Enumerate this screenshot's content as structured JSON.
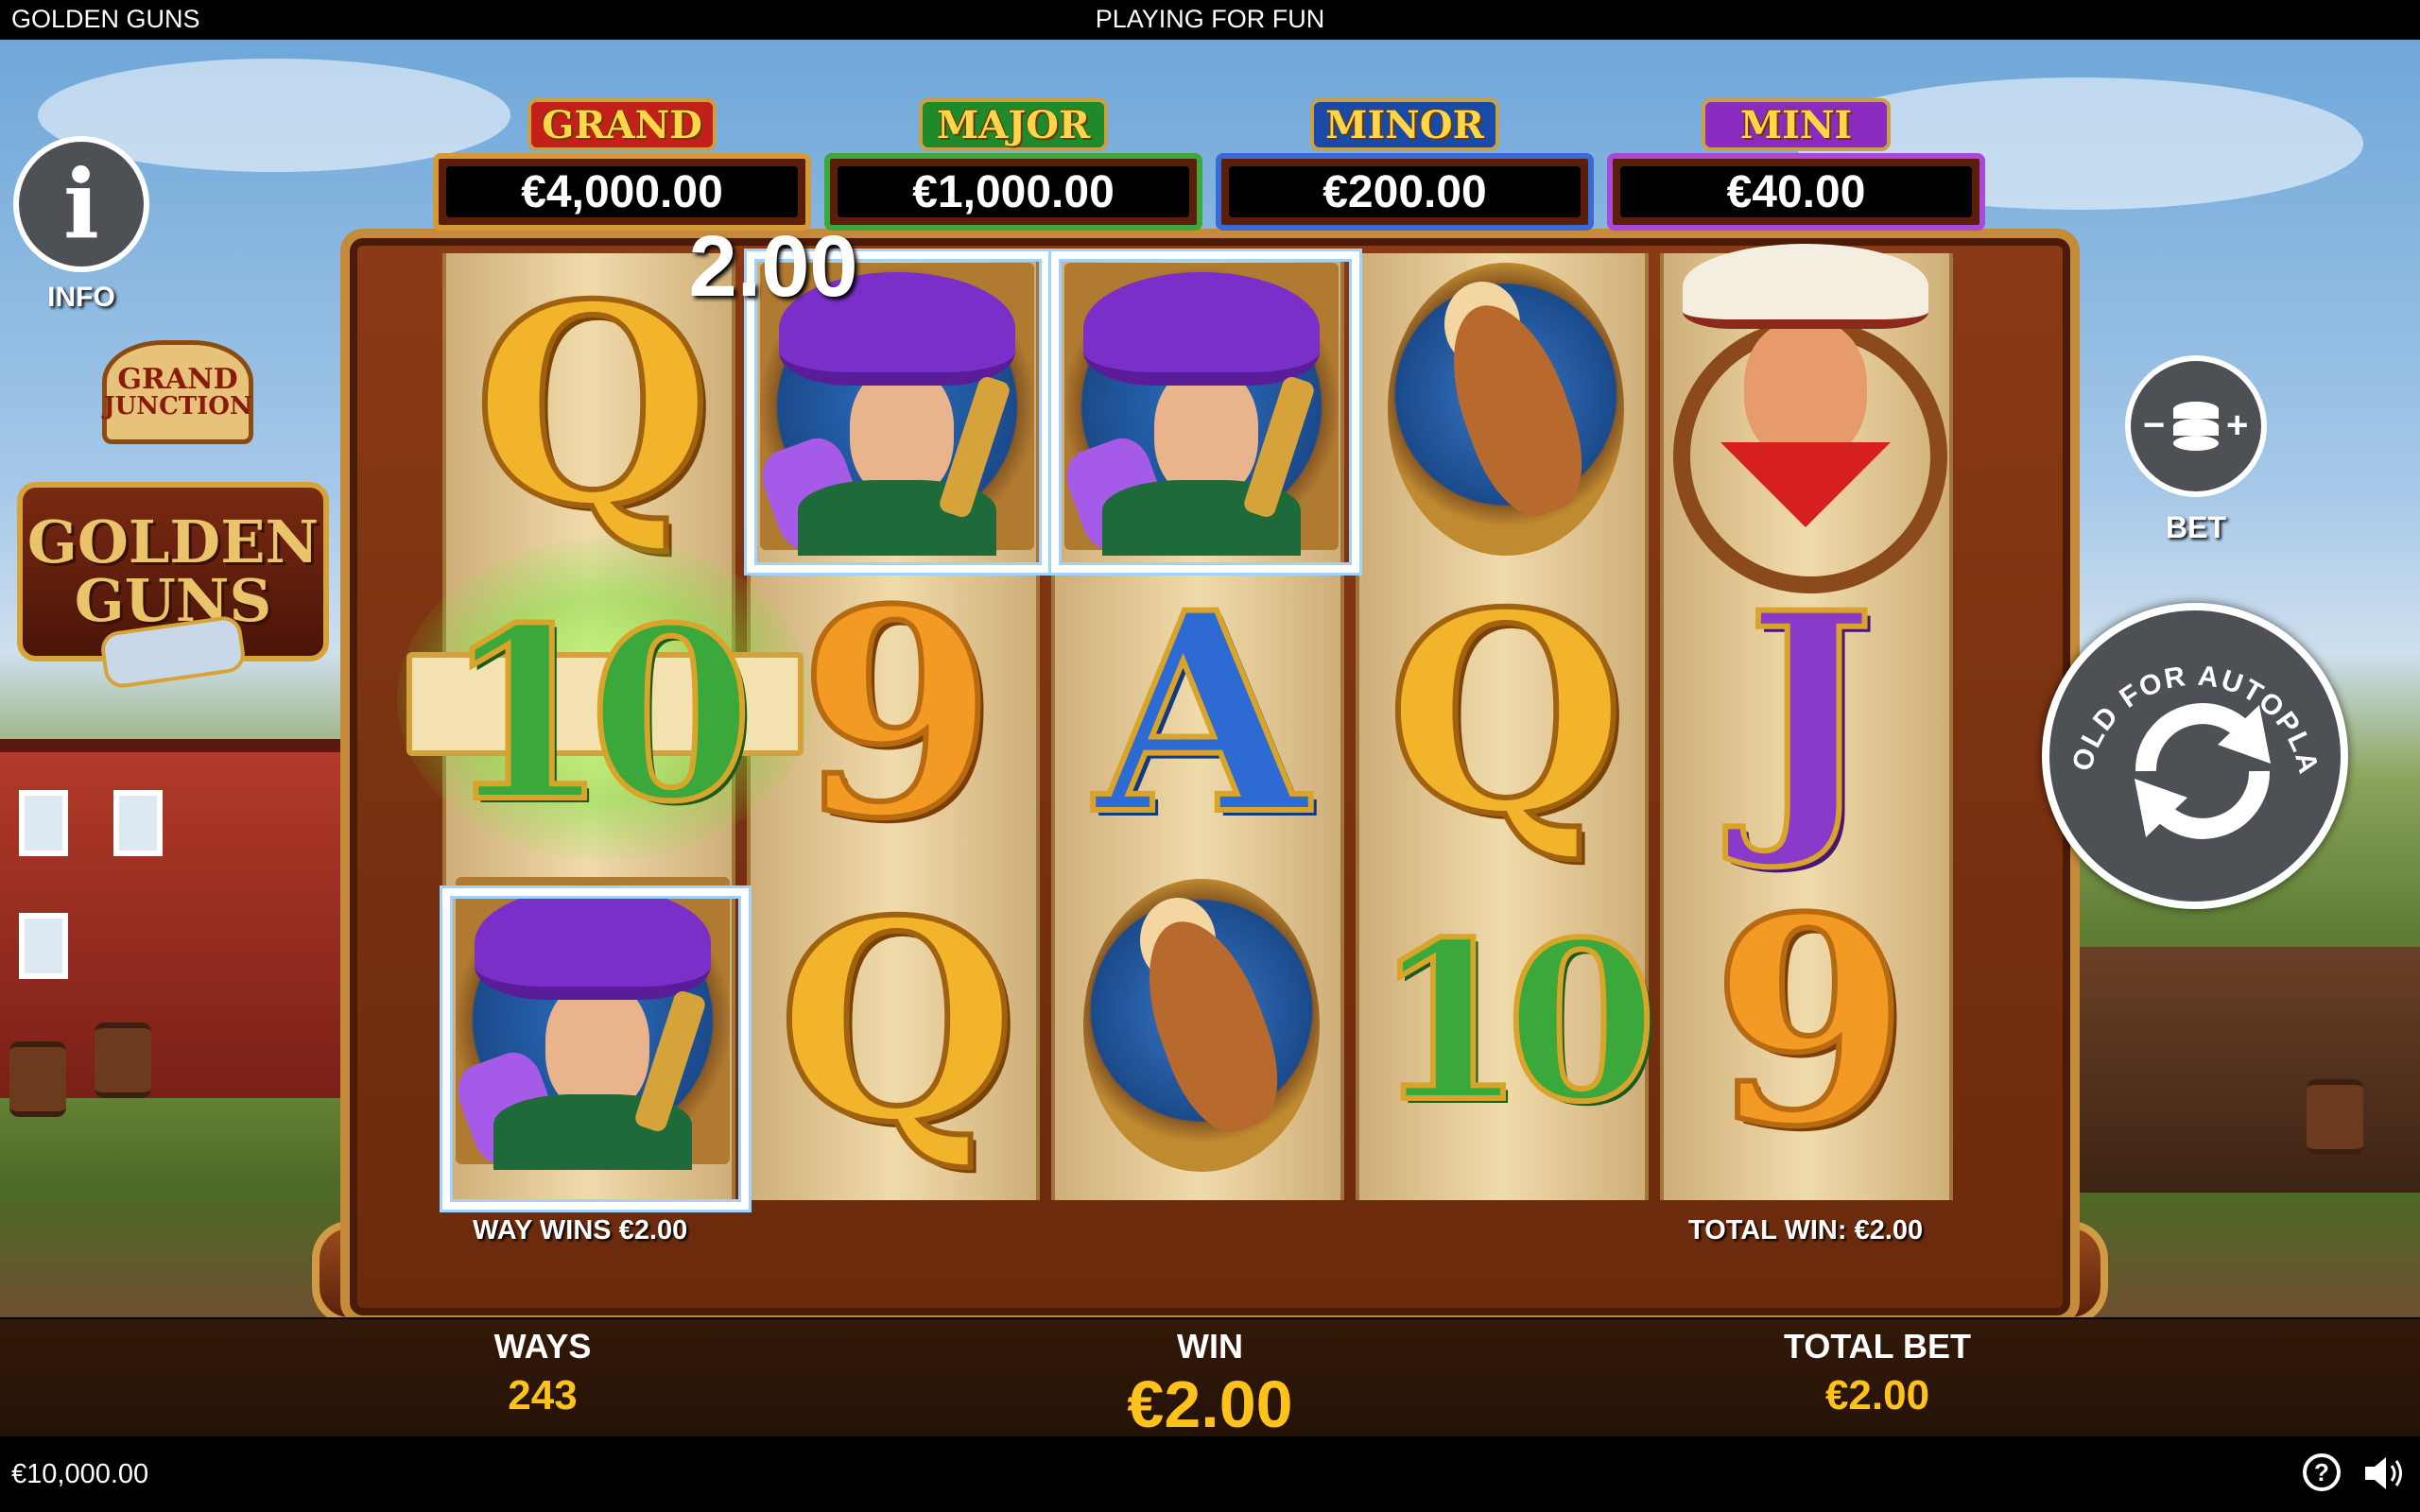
{
  "top_bar": {
    "game_title": "GOLDEN GUNS",
    "mode": "PLAYING FOR FUN"
  },
  "jackpots": [
    {
      "label": "GRAND",
      "value": "€4,000.00",
      "label_color": "#c4201a",
      "frame_color": "#c4201a"
    },
    {
      "label": "MAJOR",
      "value": "€1,000.00",
      "label_color": "#1f8a2a",
      "frame_color": "#1f8a2a"
    },
    {
      "label": "MINOR",
      "value": "€200.00",
      "label_color": "#1a4aa8",
      "frame_color": "#1a4aa8"
    },
    {
      "label": "MINI",
      "value": "€40.00",
      "label_color": "#8a2ac0",
      "frame_color": "#8a2ac0"
    }
  ],
  "left_panel": {
    "info_label": "INFO",
    "logo_line1": "GRAND",
    "logo_line2": "JUNCTION",
    "logo_title1": "GOLDEN",
    "logo_title2": "GUNS"
  },
  "right_panel": {
    "bet_label": "BET",
    "autoplay_label": "HOLD FOR AUTOPLAY"
  },
  "reels": [
    [
      "Q",
      "10",
      "outlaw-lady"
    ],
    [
      "outlaw-lady",
      "9",
      "Q"
    ],
    [
      "outlaw-lady",
      "A",
      "horse"
    ],
    [
      "horse",
      "Q",
      "10"
    ],
    [
      "cowboy",
      "J",
      "9"
    ]
  ],
  "reel_win_amount": "2.00",
  "frame_texts": {
    "way_wins": "WAY WINS €2.00",
    "total_win": "TOTAL WIN: €2.00"
  },
  "bottom_panel": {
    "ways_label": "WAYS",
    "ways_value": "243",
    "win_label": "WIN",
    "win_value": "€2.00",
    "total_bet_label": "TOTAL BET",
    "total_bet_value": "€2.00"
  },
  "bottom_bar": {
    "balance": "€10,000.00",
    "help_symbol": "?"
  },
  "colors": {
    "accent_yellow": "#ffc21a",
    "win_highlight": "#ffffff",
    "button_grey": "#4d5156"
  }
}
